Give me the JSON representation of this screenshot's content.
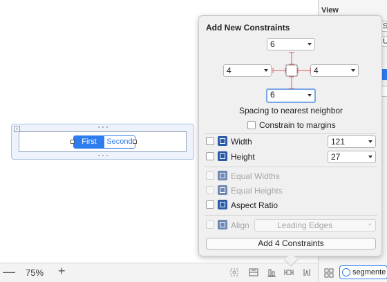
{
  "canvas": {
    "segmented_control": {
      "segments": [
        "First",
        "Second"
      ],
      "selected": "First"
    }
  },
  "bottom_bar": {
    "zoom_out": "—",
    "zoom_level": "75%",
    "zoom_in": "+"
  },
  "inspector": {
    "section_title": "View",
    "search_value": "segmente"
  },
  "popover": {
    "title": "Add New Constraints",
    "spacing": {
      "top": "6",
      "left": "4",
      "right": "4",
      "bottom": "6"
    },
    "spacing_caption": "Spacing to nearest neighbor",
    "constrain_margins_label": "Constrain to margins",
    "width": {
      "label": "Width",
      "value": "121"
    },
    "height": {
      "label": "Height",
      "value": "27"
    },
    "equal_widths_label": "Equal Widths",
    "equal_heights_label": "Equal Heights",
    "aspect_ratio_label": "Aspect Ratio",
    "align_label": "Align",
    "align_value": "Leading Edges",
    "add_button_label": "Add 4 Constraints"
  },
  "colors": {
    "accent": "#2d7cf0",
    "strut_red": "#e05a5a"
  }
}
